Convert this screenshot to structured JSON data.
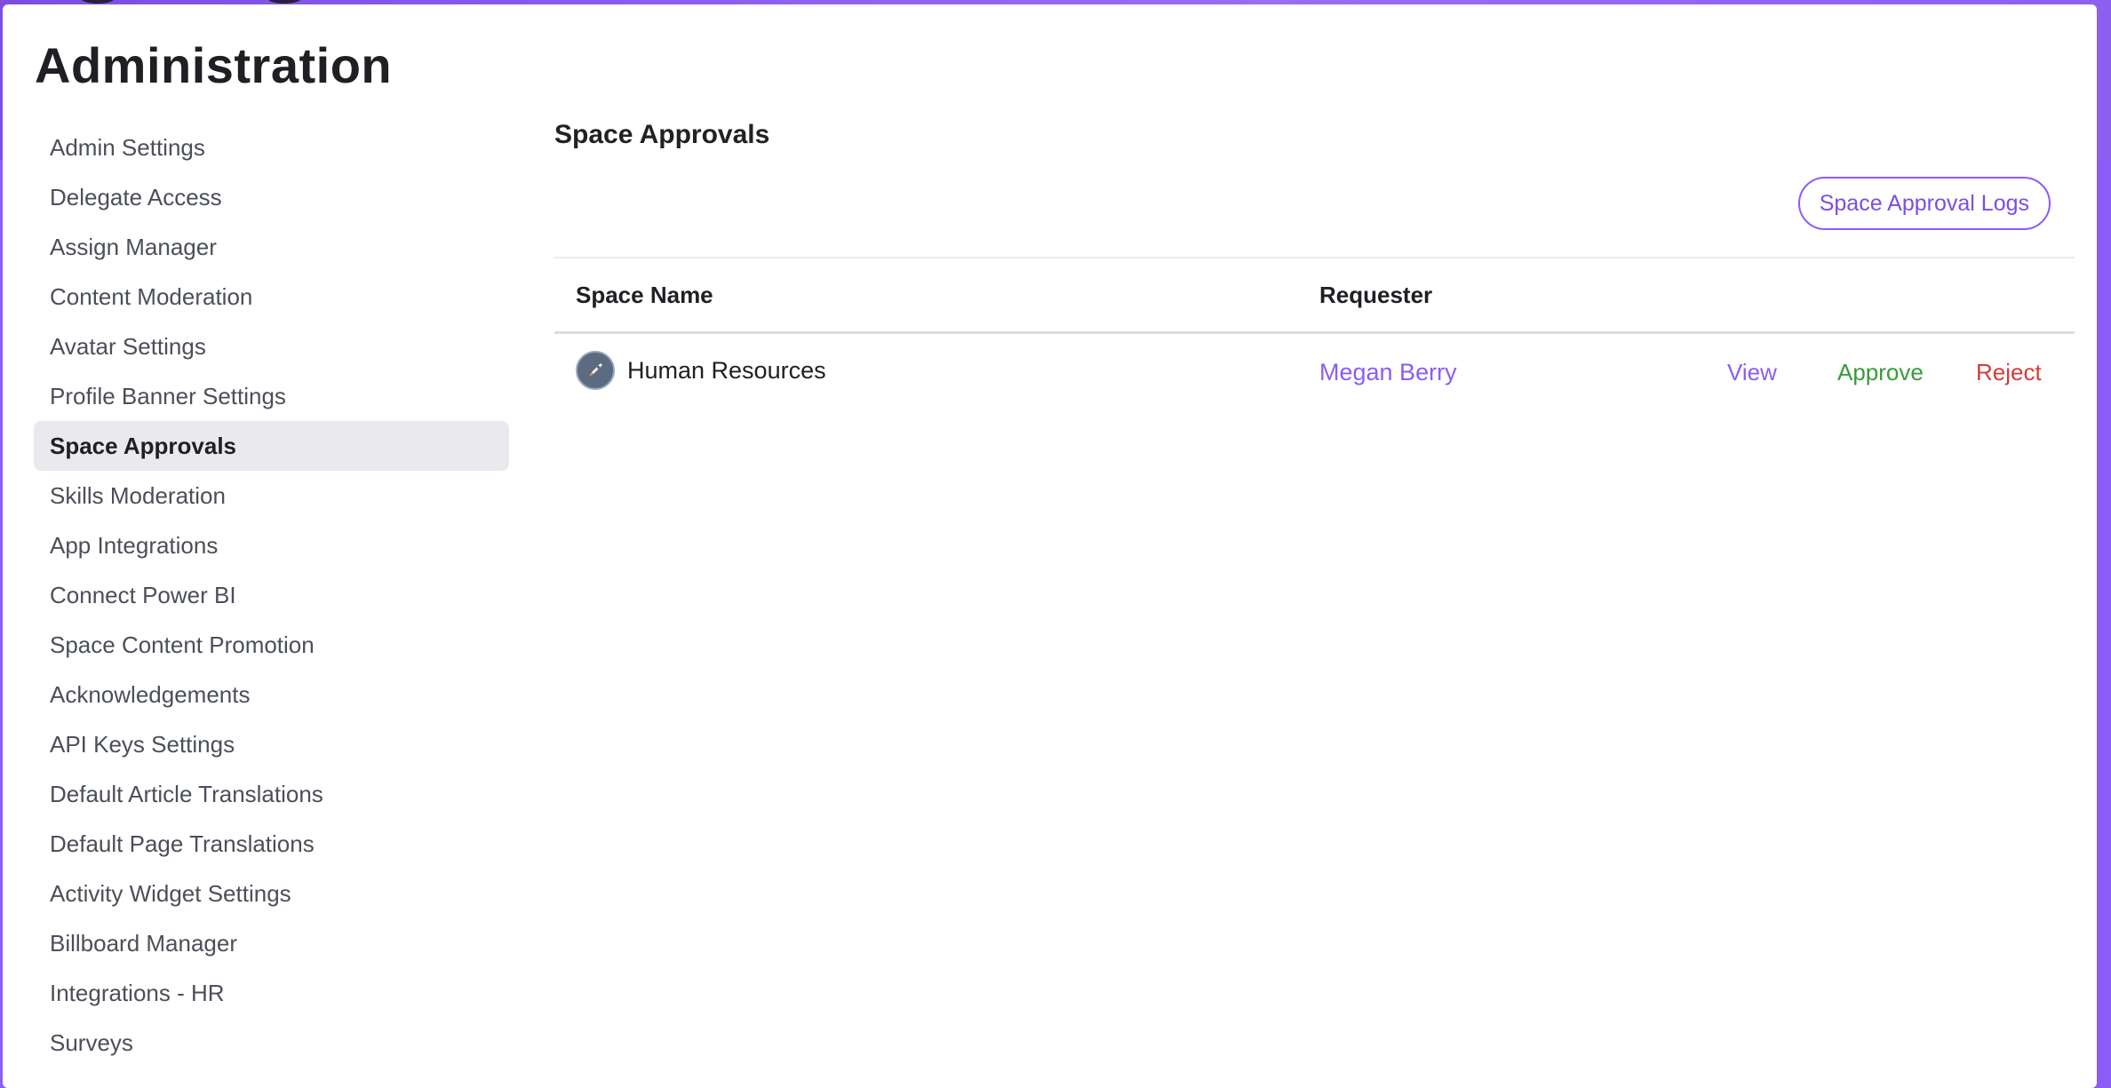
{
  "page": {
    "title": "Administration"
  },
  "sidebar": {
    "items": [
      {
        "label": "Admin Settings"
      },
      {
        "label": "Delegate Access"
      },
      {
        "label": "Assign Manager"
      },
      {
        "label": "Content Moderation"
      },
      {
        "label": "Avatar Settings"
      },
      {
        "label": "Profile Banner Settings"
      },
      {
        "label": "Space Approvals",
        "active": true
      },
      {
        "label": "Skills Moderation"
      },
      {
        "label": "App Integrations"
      },
      {
        "label": "Connect Power BI"
      },
      {
        "label": "Space Content Promotion"
      },
      {
        "label": "Acknowledgements"
      },
      {
        "label": "API Keys Settings"
      },
      {
        "label": "Default Article Translations"
      },
      {
        "label": "Default Page Translations"
      },
      {
        "label": "Activity Widget Settings"
      },
      {
        "label": "Billboard Manager"
      },
      {
        "label": "Integrations - HR"
      },
      {
        "label": "Surveys"
      }
    ]
  },
  "main": {
    "section_title": "Space Approvals",
    "logs_button_label": "Space Approval Logs",
    "table": {
      "columns": [
        "Space Name",
        "Requester"
      ],
      "rows": [
        {
          "space_name": "Human Resources",
          "space_icon": "rocket-icon",
          "requester": "Megan Berry",
          "actions": {
            "view": "View",
            "approve": "Approve",
            "reject": "Reject"
          }
        }
      ]
    }
  },
  "colors": {
    "accent": "#8b5cf6",
    "approve": "#3a9a3a",
    "reject": "#d43c3c",
    "active_item_bg": "#e9e9ee"
  }
}
